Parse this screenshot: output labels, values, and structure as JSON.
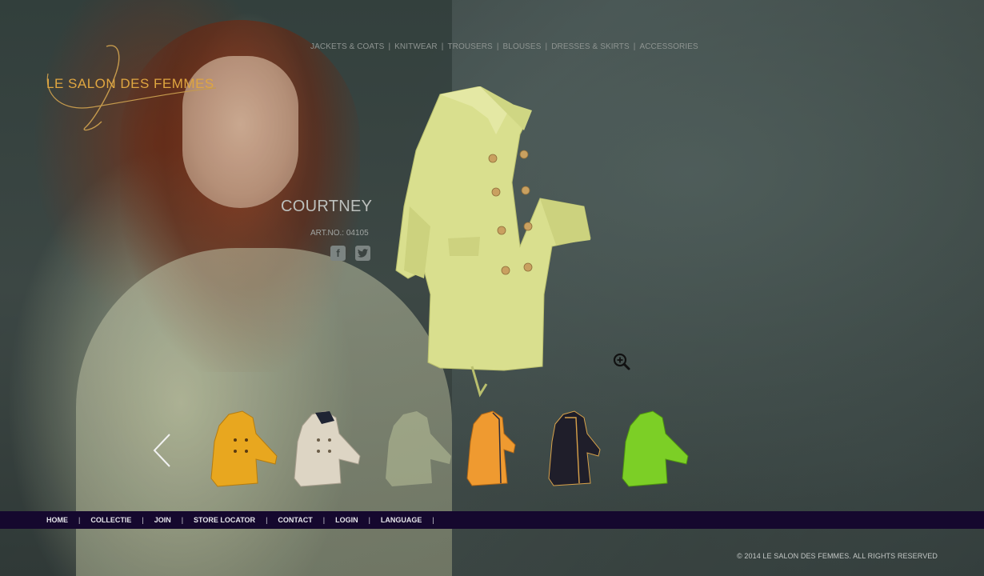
{
  "brand": {
    "name": "LE SALON DES FEMMES",
    "accent_color": "#e0a640"
  },
  "top_nav": {
    "items": [
      {
        "label": "JACKETS & COATS"
      },
      {
        "label": "KNITWEAR"
      },
      {
        "label": "TROUSERS"
      },
      {
        "label": "BLOUSES"
      },
      {
        "label": "DRESSES & SKIRTS"
      },
      {
        "label": "ACCESSORIES"
      }
    ],
    "separator": "|"
  },
  "product": {
    "name": "COURTNEY",
    "article_number": "ART.NO.: 04105",
    "social_icons": [
      "facebook-icon",
      "twitter-icon"
    ],
    "main_color": "#d9df8e"
  },
  "carousel": {
    "prev_icon": "chevron-left-icon",
    "thumbnails": [
      {
        "color": "#e8a71f"
      },
      {
        "color": "#ddd5c4"
      },
      {
        "color": "#c8d0a4"
      },
      {
        "color": "#ef9a30"
      },
      {
        "color": "#1f1e2a"
      },
      {
        "color": "#7ccf26"
      }
    ]
  },
  "bottom_nav": {
    "items": [
      {
        "label": "HOME"
      },
      {
        "label": "COLLECTIE"
      },
      {
        "label": "JOIN"
      },
      {
        "label": "STORE LOCATOR"
      },
      {
        "label": "CONTACT"
      },
      {
        "label": "LOGIN"
      },
      {
        "label": "LANGUAGE"
      }
    ],
    "separator": "|",
    "bar_color": "#15082e"
  },
  "footer": {
    "copyright": "© 2014 LE SALON DES FEMMES. ALL RIGHTS RESERVED"
  }
}
